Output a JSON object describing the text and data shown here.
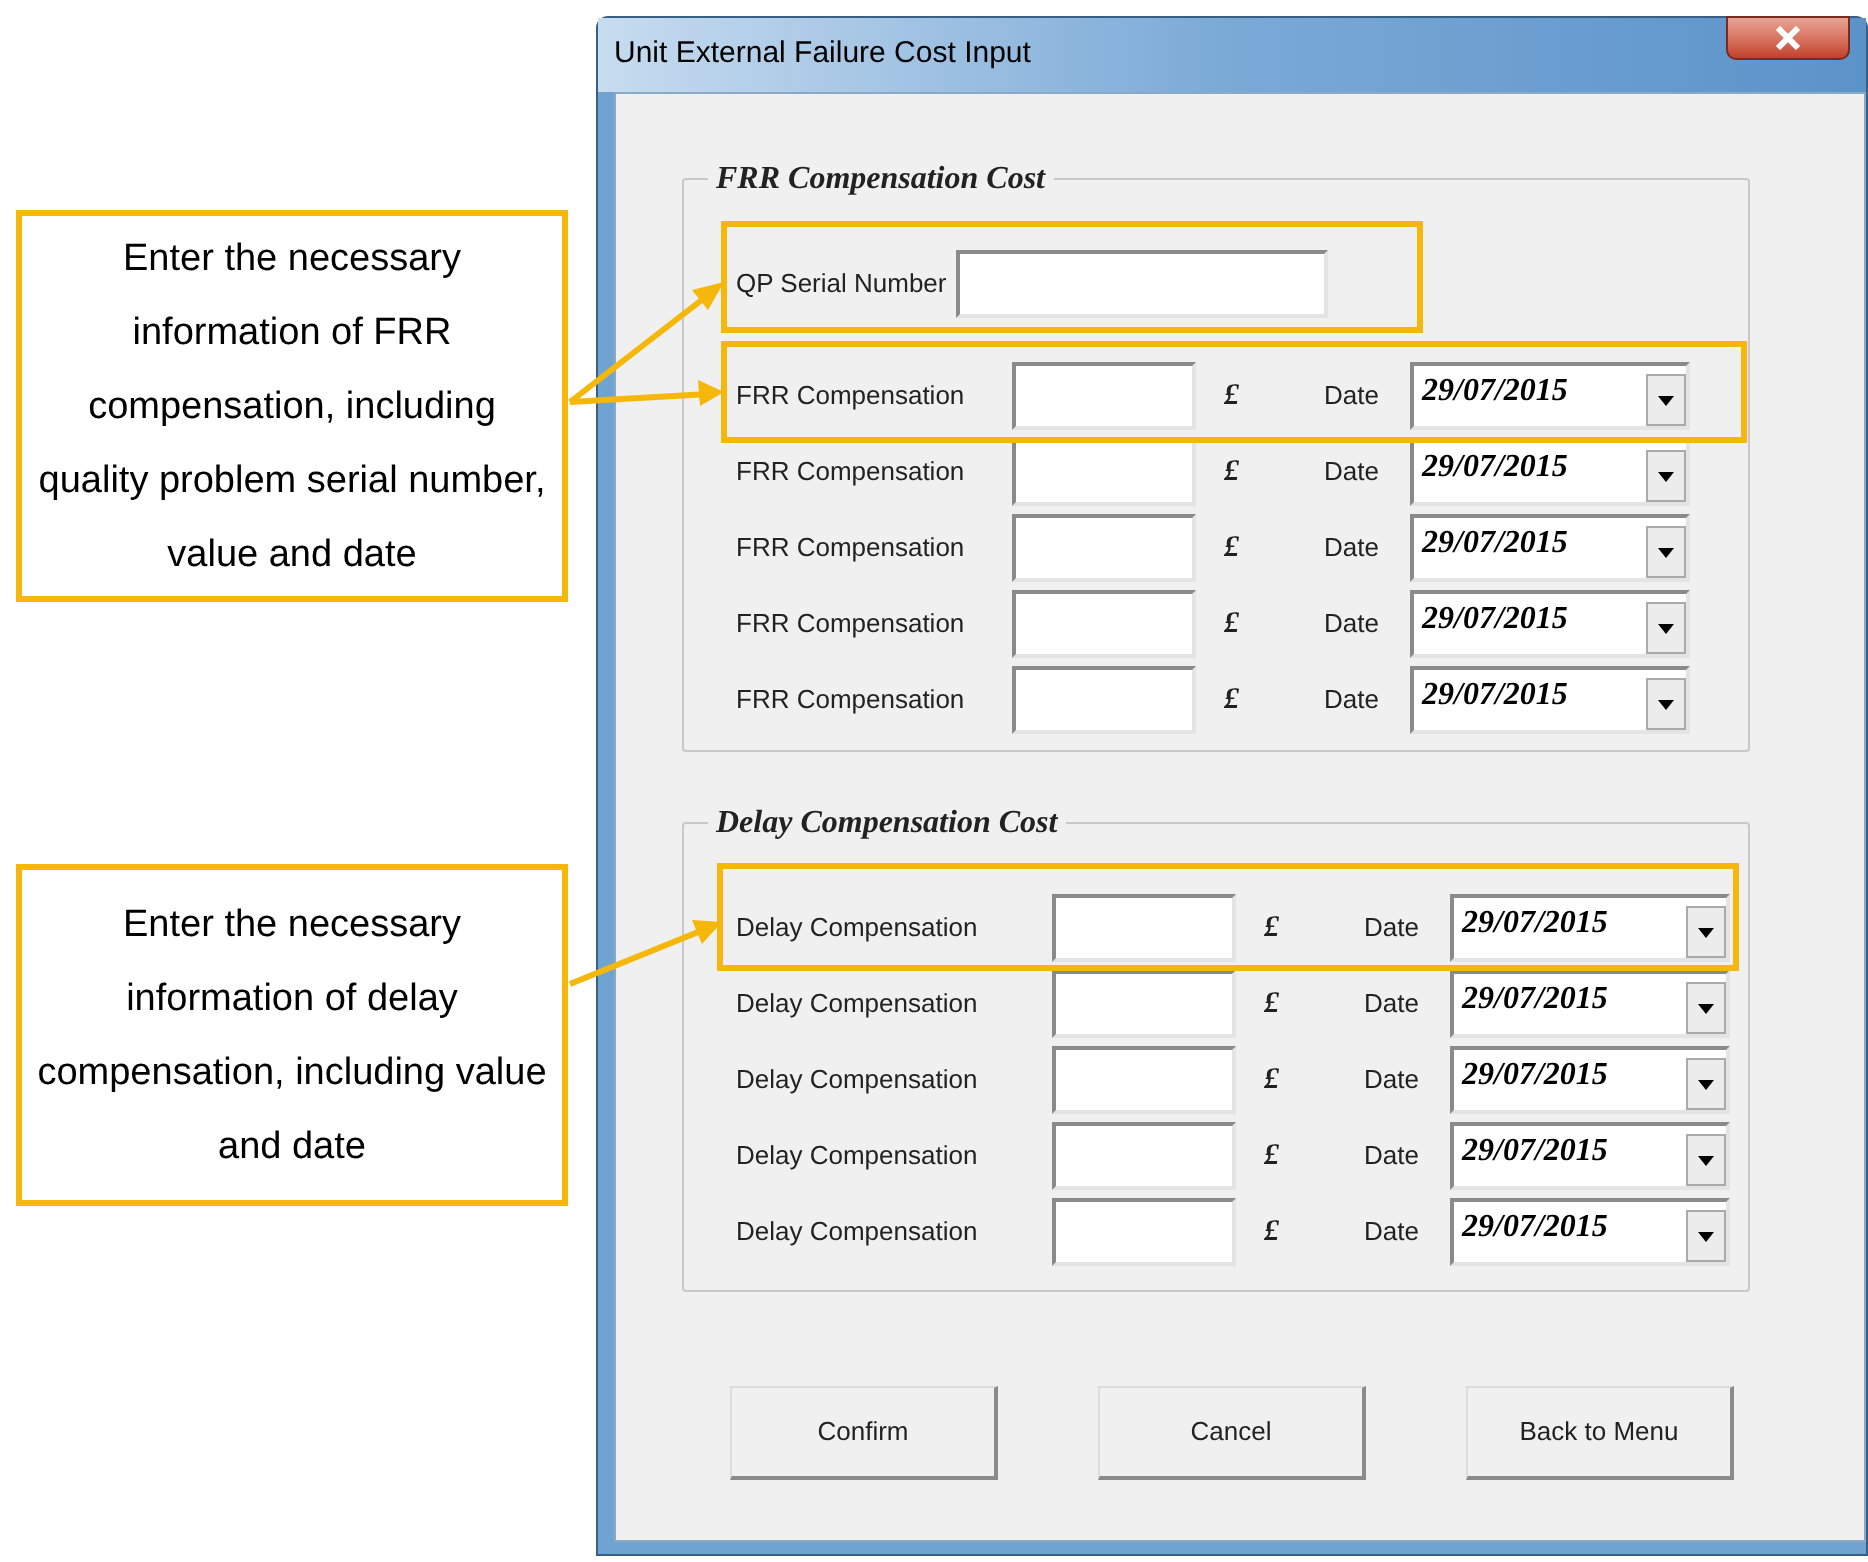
{
  "window": {
    "title": "Unit External Failure Cost Input"
  },
  "frr_section": {
    "title": "FRR Compensation Cost",
    "serial": {
      "label": "QP Serial Number"
    },
    "rows": [
      {
        "label": "FRR Compensation",
        "currency": "£",
        "date_label": "Date",
        "date": "29/07/2015"
      },
      {
        "label": "FRR Compensation",
        "currency": "£",
        "date_label": "Date",
        "date": "29/07/2015"
      },
      {
        "label": "FRR Compensation",
        "currency": "£",
        "date_label": "Date",
        "date": "29/07/2015"
      },
      {
        "label": "FRR Compensation",
        "currency": "£",
        "date_label": "Date",
        "date": "29/07/2015"
      },
      {
        "label": "FRR Compensation",
        "currency": "£",
        "date_label": "Date",
        "date": "29/07/2015"
      }
    ]
  },
  "delay_section": {
    "title": "Delay Compensation Cost",
    "rows": [
      {
        "label": "Delay Compensation",
        "currency": "£",
        "date_label": "Date",
        "date": "29/07/2015"
      },
      {
        "label": "Delay Compensation",
        "currency": "£",
        "date_label": "Date",
        "date": "29/07/2015"
      },
      {
        "label": "Delay Compensation",
        "currency": "£",
        "date_label": "Date",
        "date": "29/07/2015"
      },
      {
        "label": "Delay Compensation",
        "currency": "£",
        "date_label": "Date",
        "date": "29/07/2015"
      },
      {
        "label": "Delay Compensation",
        "currency": "£",
        "date_label": "Date",
        "date": "29/07/2015"
      }
    ]
  },
  "buttons": [
    "Confirm",
    "Cancel",
    "Back to Menu"
  ],
  "annotations": [
    {
      "text": "Enter the necessary information of FRR compensation, including quality problem serial number, value and date"
    },
    {
      "text": "Enter the necessary information of delay compensation, including value and date"
    }
  ]
}
